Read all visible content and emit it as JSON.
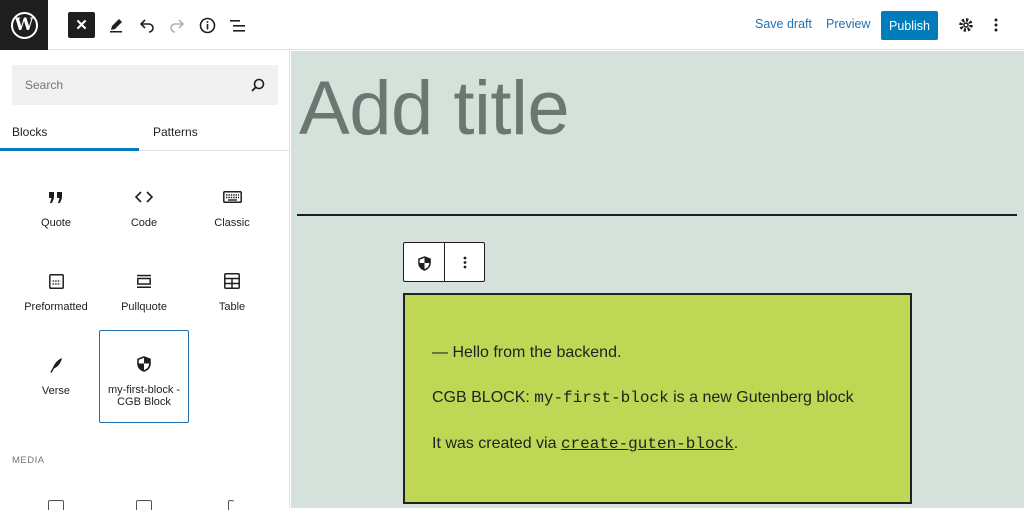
{
  "header": {
    "save_draft": "Save draft",
    "preview": "Preview",
    "publish": "Publish",
    "accent": "#007cba"
  },
  "inserter": {
    "search_placeholder": "Search",
    "tabs": [
      {
        "label": "Blocks",
        "active": true
      },
      {
        "label": "Patterns",
        "active": false
      }
    ],
    "blocks": [
      {
        "label": "Quote",
        "icon": "quote-icon"
      },
      {
        "label": "Code",
        "icon": "code-icon"
      },
      {
        "label": "Classic",
        "icon": "keyboard-icon"
      },
      {
        "label": "Preformatted",
        "icon": "preformatted-icon"
      },
      {
        "label": "Pullquote",
        "icon": "pullquote-icon"
      },
      {
        "label": "Table",
        "icon": "table-icon"
      },
      {
        "label": "Verse",
        "icon": "feather-icon"
      },
      {
        "label": "my-first-block - CGB Block",
        "icon": "shield-icon",
        "selected": true
      }
    ],
    "media_heading": "MEDIA"
  },
  "editor": {
    "title_placeholder": "Add title",
    "block_bg": "#bed855",
    "block_lines": {
      "line1": "— Hello from the backend.",
      "line2_pre": "CGB BLOCK: ",
      "line2_code": "my-first-block",
      "line2_post": " is a new Gutenberg block",
      "line3_pre": "It was created via ",
      "line3_code": "create-guten-block",
      "line3_post": "."
    }
  }
}
